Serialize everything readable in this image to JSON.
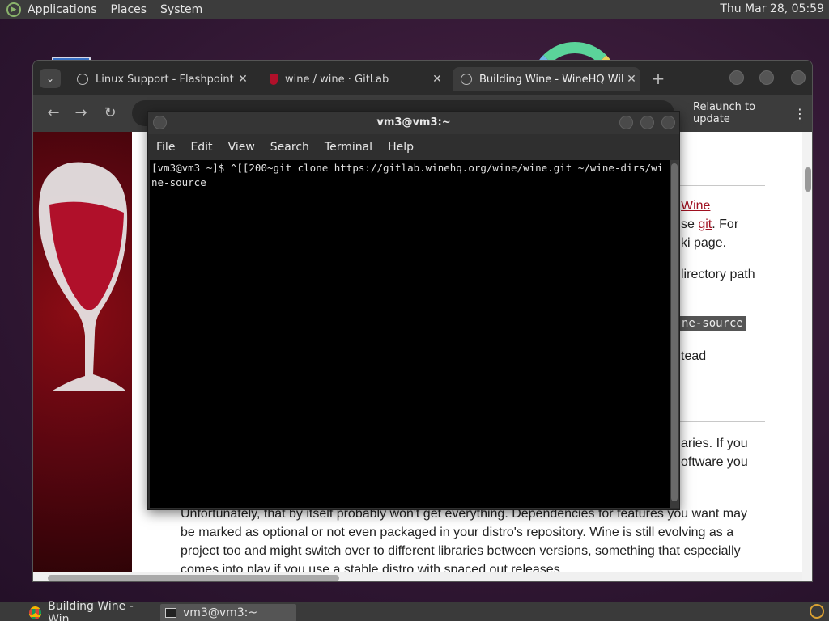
{
  "top_panel": {
    "menus": [
      "Applications",
      "Places",
      "System"
    ],
    "clock": "Thu Mar 28, 05:59"
  },
  "browser": {
    "tabs": [
      {
        "title": "Linux Support - Flashpoint D...",
        "close": "✕"
      },
      {
        "title": "wine / wine · GitLab",
        "close": "✕"
      },
      {
        "title": "Building Wine - WineHQ Wiki",
        "close": "✕"
      }
    ],
    "new_tab": "+",
    "relaunch_label": "Relaunch to update",
    "page": {
      "frag1_link": "Wine",
      "frag2_pre": "se ",
      "frag2_link": "git",
      "frag2_post": ". For",
      "frag3": "ki page.",
      "frag4": "lirectory path",
      "frag5_code": "ne-source",
      "frag6": "tead",
      "frag7": "aries. If you",
      "frag8": "oftware you",
      "para_line1": "Unfortunately, that by itself probably won't get everything. Dependencies for features you want may",
      "para_line2": "be marked as optional or not even packaged in your distro's repository. Wine is still evolving as a",
      "para_line3": "project too and might switch over to different libraries between versions, something that especially",
      "para_line4": "comes into play if you use a stable distro with spaced out releases."
    }
  },
  "terminal": {
    "title": "vm3@vm3:~",
    "menus": [
      "File",
      "Edit",
      "View",
      "Search",
      "Terminal",
      "Help"
    ],
    "output": "[vm3@vm3 ~]$ ^[[200~git clone https://gitlab.winehq.org/wine/wine.git ~/wine-dirs/wine-source"
  },
  "taskbar": {
    "items": [
      "Building Wine - Win...",
      "vm3@vm3:~"
    ]
  }
}
